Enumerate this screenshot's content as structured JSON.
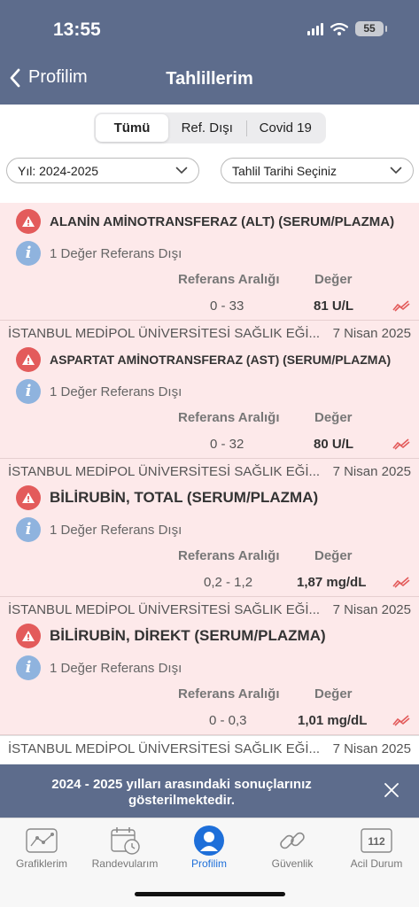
{
  "status_bar": {
    "time": "13:55",
    "battery": "55"
  },
  "nav": {
    "back_label": "Profilim",
    "title": "Tahlillerim"
  },
  "segments": {
    "all": "Tümü",
    "ref_out": "Ref. Dışı",
    "covid": "Covid 19"
  },
  "filters": {
    "year": "Yıl: 2024-2025",
    "date": "Tahlil Tarihi Seçiniz"
  },
  "column_headers": {
    "range": "Referans Aralığı",
    "value": "Değer"
  },
  "results": [
    {
      "test": "ALANİN AMİNOTRANSFERAZ (ALT) (SERUM/PLAZMA)",
      "info": "1 Değer Referans Dışı",
      "range": "0 - 33",
      "value": "81 U/L"
    },
    {
      "institution": "İSTANBUL MEDİPOL ÜNİVERSİTESİ SAĞLIK EĞİ...",
      "date": "7 Nisan 2025",
      "test": "ASPARTAT AMİNOTRANSFERAZ (AST) (SERUM/PLAZMA)",
      "info": "1 Değer Referans Dışı",
      "range": "0 - 32",
      "value": "80 U/L"
    },
    {
      "institution": "İSTANBUL MEDİPOL ÜNİVERSİTESİ SAĞLIK EĞİ...",
      "date": "7 Nisan 2025",
      "test": "BİLİRUBİN, TOTAL (SERUM/PLAZMA)",
      "info": "1 Değer Referans Dışı",
      "range": "0,2 - 1,2",
      "value": "1,87 mg/dL"
    },
    {
      "institution": "İSTANBUL MEDİPOL ÜNİVERSİTESİ SAĞLIK EĞİ...",
      "date": "7 Nisan 2025",
      "test": "BİLİRUBİN, DİREKT (SERUM/PLAZMA)",
      "info": "1 Değer Referans Dışı",
      "range": "0 - 0,3",
      "value": "1,01 mg/dL"
    },
    {
      "institution": "İSTANBUL MEDİPOL ÜNİVERSİTESİ SAĞLIK EĞİ...",
      "date": "7 Nisan 2025"
    }
  ],
  "toast": {
    "message": "2024 - 2025 yılları arasındaki sonuçlarınız gösterilmektedir."
  },
  "tabs": [
    {
      "label": "Grafiklerim",
      "icon": "chart-icon"
    },
    {
      "label": "Randevularım",
      "icon": "calendar-clock-icon"
    },
    {
      "label": "Profilim",
      "icon": "person-icon"
    },
    {
      "label": "Güvenlik",
      "icon": "link-icon"
    },
    {
      "label": "Acil Durum",
      "icon": "emergency-112-icon"
    }
  ],
  "icon_number": "112",
  "colors": {
    "header": "#5d6c8c",
    "card_bg": "#fde9ea",
    "warning": "#e35b5b",
    "info": "#8fb3de",
    "active_tab": "#1e6fd9"
  }
}
